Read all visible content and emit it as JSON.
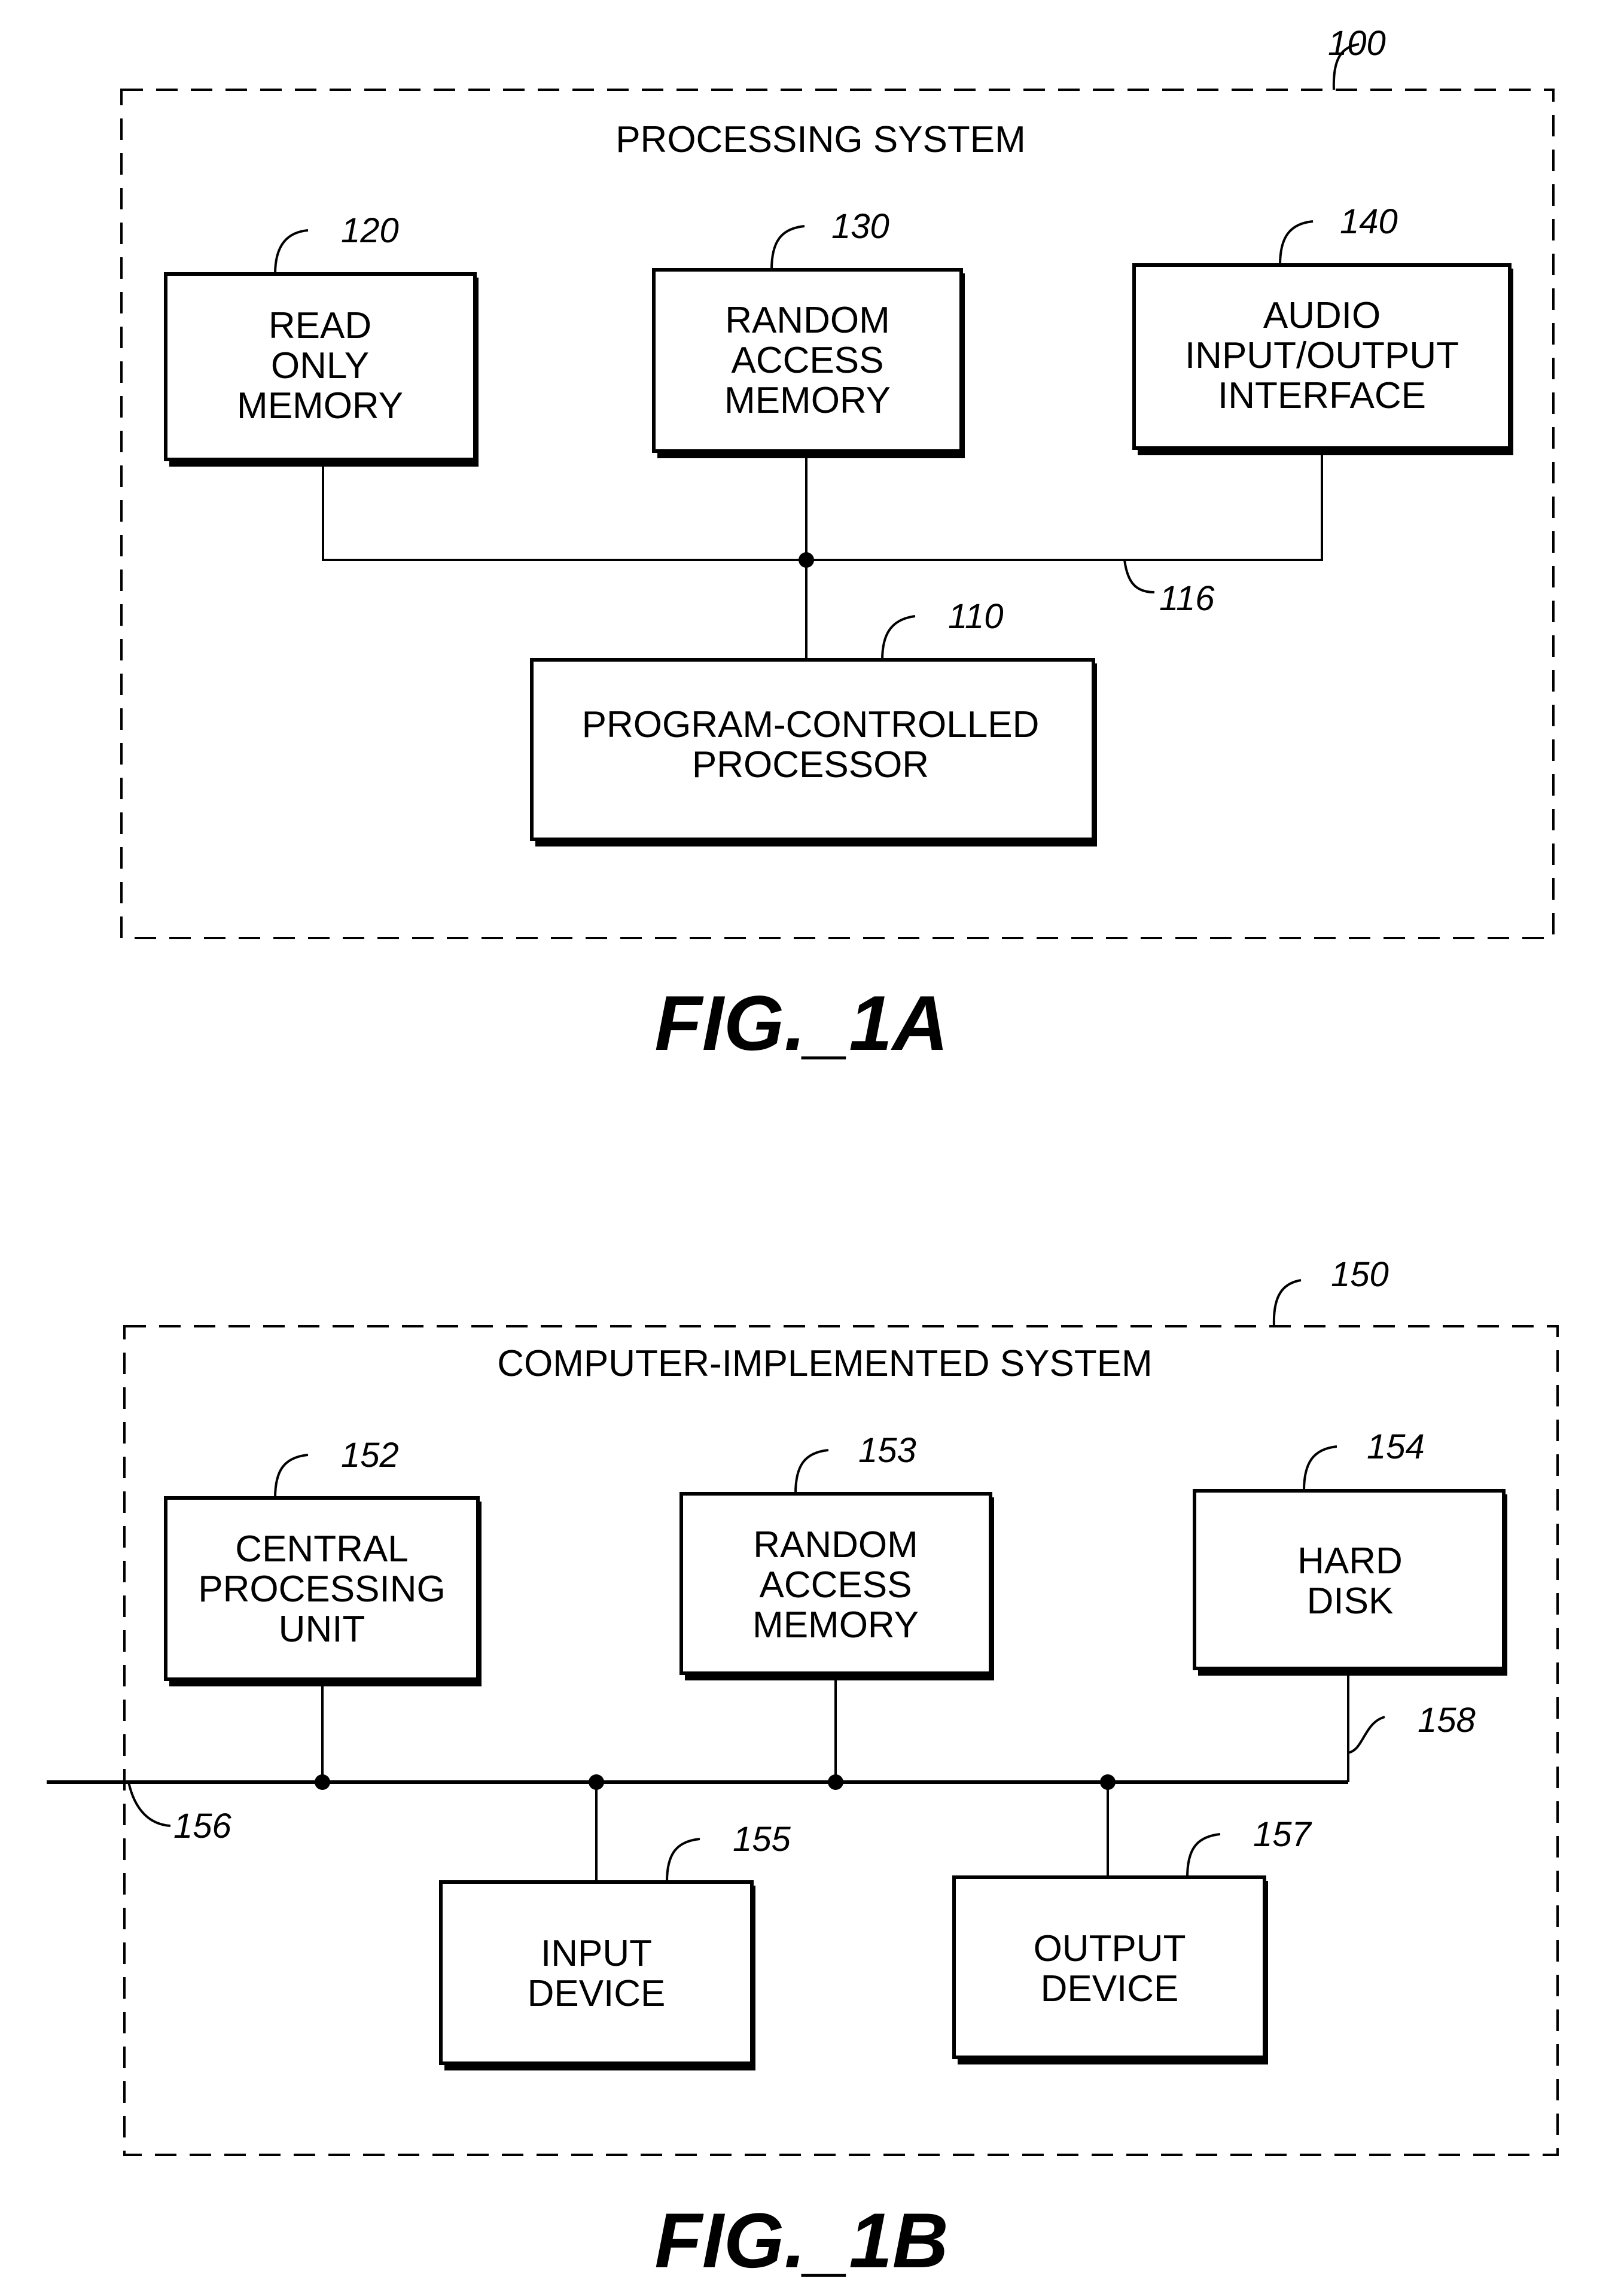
{
  "figures": [
    {
      "id": "fig1a",
      "caption": "FIG._1A",
      "system": {
        "ref": "100",
        "title": "PROCESSING SYSTEM"
      },
      "bus_ref": "116",
      "blocks": [
        {
          "ref": "120",
          "lines": [
            "READ",
            "ONLY",
            "MEMORY"
          ]
        },
        {
          "ref": "130",
          "lines": [
            "RANDOM",
            "ACCESS",
            "MEMORY"
          ]
        },
        {
          "ref": "140",
          "lines": [
            "AUDIO",
            "INPUT/OUTPUT",
            "INTERFACE"
          ]
        },
        {
          "ref": "110",
          "lines": [
            "PROGRAM-CONTROLLED",
            "PROCESSOR"
          ]
        }
      ]
    },
    {
      "id": "fig1b",
      "caption": "FIG._1B",
      "system": {
        "ref": "150",
        "title": "COMPUTER-IMPLEMENTED SYSTEM"
      },
      "bus_ref": "156",
      "hd_link_ref": "158",
      "blocks": [
        {
          "ref": "152",
          "lines": [
            "CENTRAL",
            "PROCESSING",
            "UNIT"
          ]
        },
        {
          "ref": "153",
          "lines": [
            "RANDOM",
            "ACCESS",
            "MEMORY"
          ]
        },
        {
          "ref": "154",
          "lines": [
            "HARD",
            "DISK"
          ]
        },
        {
          "ref": "155",
          "lines": [
            "INPUT",
            "DEVICE"
          ]
        },
        {
          "ref": "157",
          "lines": [
            "OUTPUT",
            "DEVICE"
          ]
        }
      ]
    }
  ]
}
